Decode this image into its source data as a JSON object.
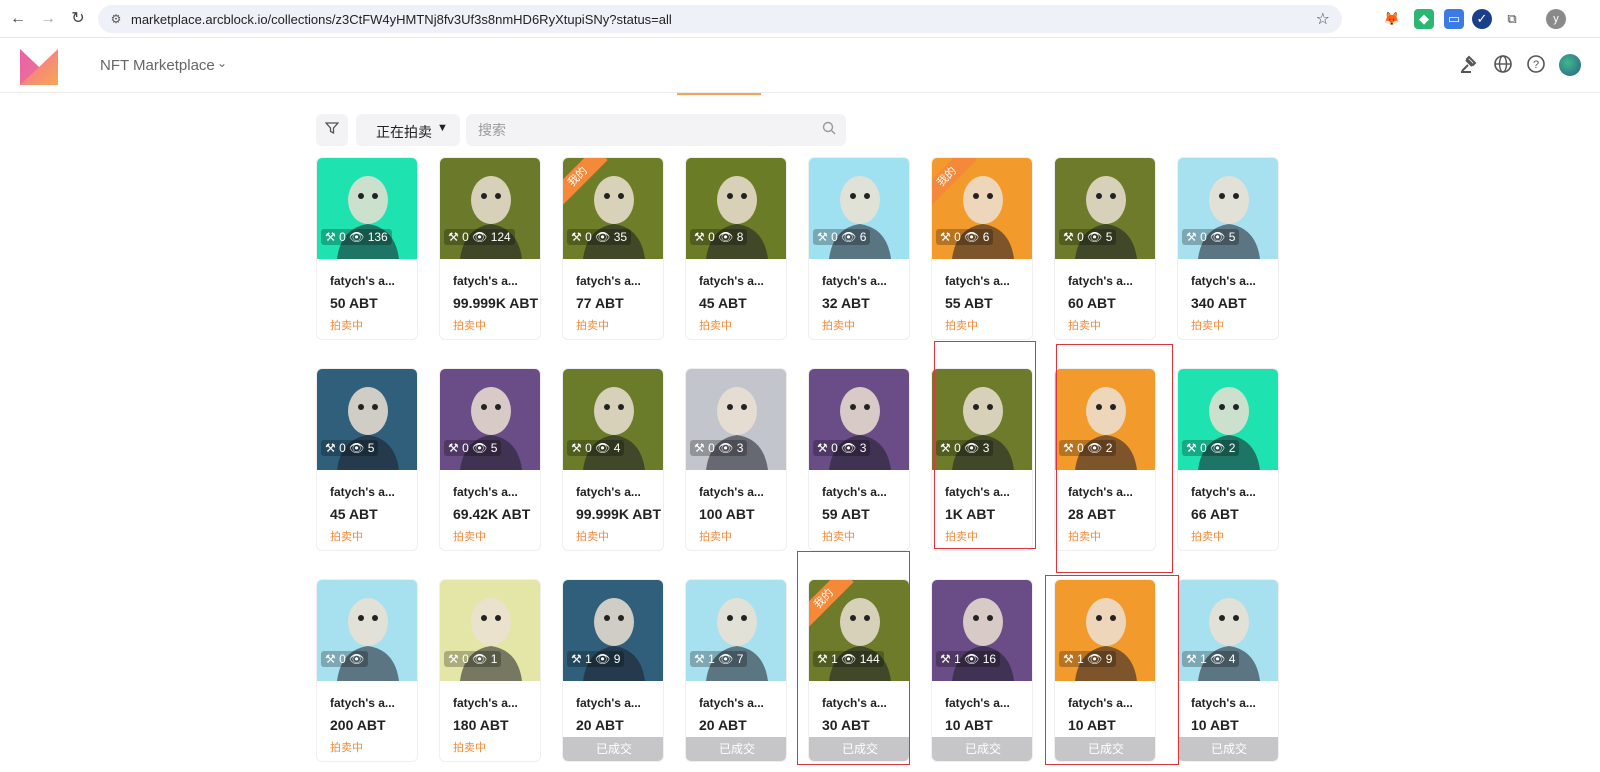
{
  "browser": {
    "url": "marketplace.arcblock.io/collections/z3CtFW4yHMTNj8fv3Uf3s8nmHD6RyXtupiSNy?status=all",
    "profile_initial": "y"
  },
  "header": {
    "app_title": "NFT Marketplace"
  },
  "filters": {
    "status_label": "正在拍卖",
    "search_placeholder": "搜索"
  },
  "colors": {
    "accent": "#f08a3a",
    "sold_bar": "#c6c6c9",
    "highlight": "#d9363e"
  },
  "cards": [
    {
      "name": "fatych's a...",
      "price": "50 ABT",
      "status": "拍卖中",
      "bids": "0",
      "views": "136",
      "bg": "#1ee3b0",
      "mine": false,
      "sold": false
    },
    {
      "name": "fatych's a...",
      "price": "99.999K ABT",
      "status": "拍卖中",
      "bids": "0",
      "views": "124",
      "bg": "#6a7a2a",
      "mine": false,
      "sold": false
    },
    {
      "name": "fatych's a...",
      "price": "77 ABT",
      "status": "拍卖中",
      "bids": "0",
      "views": "35",
      "bg": "#6e7d27",
      "mine": true,
      "sold": false
    },
    {
      "name": "fatych's a...",
      "price": "45 ABT",
      "status": "拍卖中",
      "bids": "0",
      "views": "8",
      "bg": "#6b7c26",
      "mine": false,
      "sold": false
    },
    {
      "name": "fatych's a...",
      "price": "32 ABT",
      "status": "拍卖中",
      "bids": "0",
      "views": "6",
      "bg": "#9fe1f0",
      "mine": false,
      "sold": false
    },
    {
      "name": "fatych's a...",
      "price": "55 ABT",
      "status": "拍卖中",
      "bids": "0",
      "views": "6",
      "bg": "#f39a2d",
      "mine": true,
      "sold": false
    },
    {
      "name": "fatych's a...",
      "price": "60 ABT",
      "status": "拍卖中",
      "bids": "0",
      "views": "5",
      "bg": "#6e7b2a",
      "mine": false,
      "sold": false
    },
    {
      "name": "fatych's a...",
      "price": "340 ABT",
      "status": "拍卖中",
      "bids": "0",
      "views": "5",
      "bg": "#a7e0ef",
      "mine": false,
      "sold": false
    },
    {
      "name": "fatych's a...",
      "price": "45 ABT",
      "status": "拍卖中",
      "bids": "0",
      "views": "5",
      "bg": "#2f5f7a",
      "mine": false,
      "sold": false
    },
    {
      "name": "fatych's a...",
      "price": "69.42K ABT",
      "status": "拍卖中",
      "bids": "0",
      "views": "5",
      "bg": "#6a4c86",
      "mine": false,
      "sold": false
    },
    {
      "name": "fatych's a...",
      "price": "99.999K ABT",
      "status": "拍卖中",
      "bids": "0",
      "views": "4",
      "bg": "#6a7c2a",
      "mine": false,
      "sold": false
    },
    {
      "name": "fatych's a...",
      "price": "100 ABT",
      "status": "拍卖中",
      "bids": "0",
      "views": "3",
      "bg": "#c2c6cc",
      "mine": false,
      "sold": false
    },
    {
      "name": "fatych's a...",
      "price": "59 ABT",
      "status": "拍卖中",
      "bids": "0",
      "views": "3",
      "bg": "#6a4c86",
      "mine": false,
      "sold": false
    },
    {
      "name": "fatych's a...",
      "price": "1K ABT",
      "status": "拍卖中",
      "bids": "0",
      "views": "3",
      "bg": "#6d7b2a",
      "mine": false,
      "sold": false
    },
    {
      "name": "fatych's a...",
      "price": "28 ABT",
      "status": "拍卖中",
      "bids": "0",
      "views": "2",
      "bg": "#f39a2d",
      "mine": false,
      "sold": false
    },
    {
      "name": "fatych's a...",
      "price": "66 ABT",
      "status": "拍卖中",
      "bids": "0",
      "views": "2",
      "bg": "#1ee3b0",
      "mine": false,
      "sold": false
    },
    {
      "name": "fatych's a...",
      "price": "200 ABT",
      "status": "拍卖中",
      "bids": "0",
      "views": "",
      "bg": "#a7e0ef",
      "mine": false,
      "sold": false
    },
    {
      "name": "fatych's a...",
      "price": "180 ABT",
      "status": "拍卖中",
      "bids": "0",
      "views": "1",
      "bg": "#e3e6a6",
      "mine": false,
      "sold": false
    },
    {
      "name": "fatych's a...",
      "price": "20 ABT",
      "status": "已成交",
      "bids": "1",
      "views": "9",
      "bg": "#2f5f7a",
      "mine": false,
      "sold": true
    },
    {
      "name": "fatych's a...",
      "price": "20 ABT",
      "status": "已成交",
      "bids": "1",
      "views": "7",
      "bg": "#a7e0ef",
      "mine": false,
      "sold": true
    },
    {
      "name": "fatych's a...",
      "price": "30 ABT",
      "status": "已成交",
      "bids": "1",
      "views": "144",
      "bg": "#6d7b2a",
      "mine": true,
      "sold": true
    },
    {
      "name": "fatych's a...",
      "price": "10 ABT",
      "status": "已成交",
      "bids": "1",
      "views": "16",
      "bg": "#6a4c86",
      "mine": false,
      "sold": true
    },
    {
      "name": "fatych's a...",
      "price": "10 ABT",
      "status": "已成交",
      "bids": "1",
      "views": "9",
      "bg": "#f39a2d",
      "mine": false,
      "sold": true
    },
    {
      "name": "fatych's a...",
      "price": "10 ABT",
      "status": "已成交",
      "bids": "1",
      "views": "4",
      "bg": "#a7e0ef",
      "mine": false,
      "sold": true
    }
  ],
  "mine_badge": "我的"
}
